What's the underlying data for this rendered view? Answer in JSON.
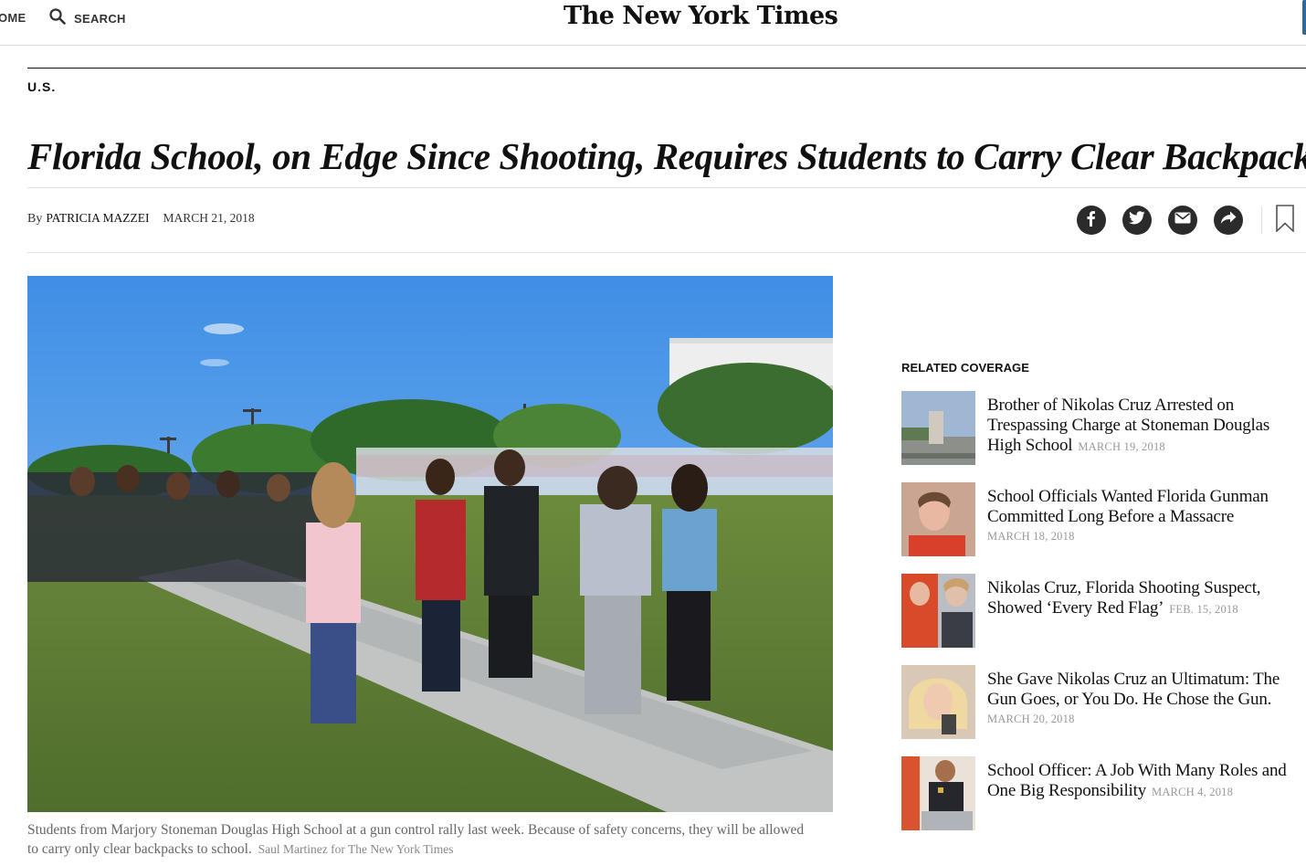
{
  "nav": {
    "home_label": "OME",
    "search_label": "SEARCH",
    "logo_text": "The New York Times",
    "edge_color": "#326891"
  },
  "article": {
    "section": "U.S.",
    "headline": "Florida School, on Edge Since Shooting, Requires Students to Carry Clear Backpacks",
    "byline_prefix": "By",
    "author": "PATRICIA MAZZEI",
    "date": "MARCH 21, 2018",
    "share_icons": [
      "facebook-icon",
      "twitter-icon",
      "email-icon",
      "share-icon",
      "bookmark-icon"
    ],
    "photo_caption": "Students from Marjory Stoneman Douglas High School at a gun control rally last week. Because of safety concerns, they will be allowed to carry only clear backpacks to school.",
    "photo_credit": "Saul Martinez for The New York Times"
  },
  "related": {
    "title": "RELATED COVERAGE",
    "items": [
      {
        "headline": "Brother of Nikolas Cruz Arrested on Trespassing Charge at Stoneman Douglas High School",
        "date": "MARCH 19, 2018"
      },
      {
        "headline": "School Officials Wanted Florida Gunman Committed Long Before a Massacre",
        "date": "MARCH 18, 2018"
      },
      {
        "headline": "Nikolas Cruz, Florida Shooting Suspect, Showed ‘Every Red Flag’",
        "date": "FEB. 15, 2018"
      },
      {
        "headline": "She Gave Nikolas Cruz an Ultimatum: The Gun Goes, or You Do. He Chose the Gun.",
        "date": "MARCH 20, 2018"
      },
      {
        "headline": "School Officer: A Job With Many Roles and One Big Responsibility",
        "date": "MARCH 4, 2018"
      }
    ]
  }
}
